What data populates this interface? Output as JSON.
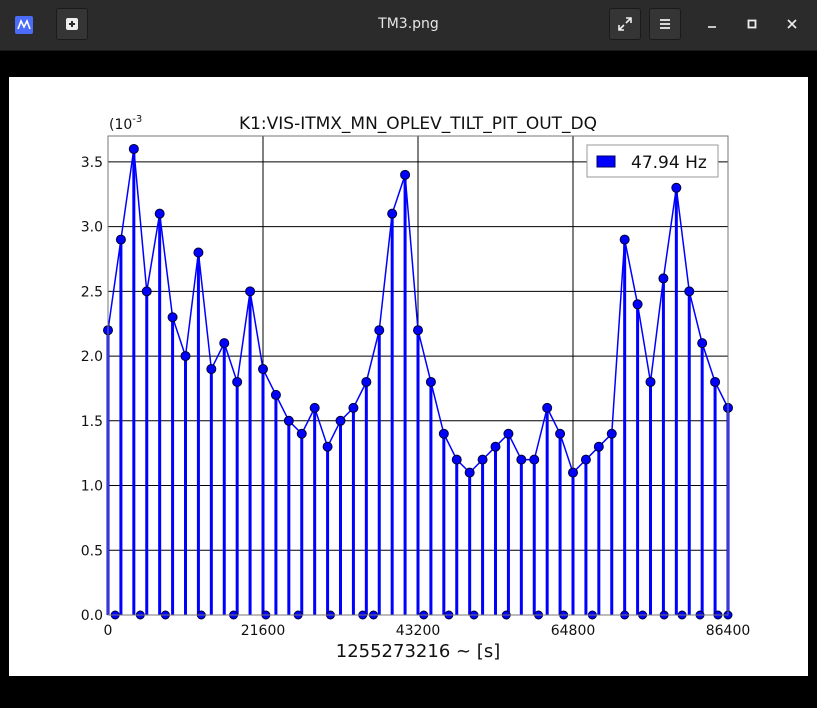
{
  "window": {
    "title": "TM3.png",
    "app_icon": "image-viewer-icon",
    "buttons": {
      "new_tab": "plus-icon",
      "fullscreen": "expand-icon",
      "menu": "hamburger-icon",
      "minimize": "minimize-icon",
      "maximize": "maximize-icon",
      "close": "close-icon"
    }
  },
  "colors": {
    "series": "#0000ff",
    "marker_edge": "#000033",
    "titlebar": "#2b2b2b"
  },
  "chart_data": {
    "type": "scatter",
    "title": "K1:VIS-ITMX_MN_OPLEV_TILT_PIT_OUT_DQ",
    "xlabel": "1255273216 ~ [s]",
    "ylabel": "",
    "y_multiplier": "(10",
    "y_exponent": "-3",
    "xlim": [
      0,
      86400
    ],
    "ylim": [
      0,
      0.0037
    ],
    "xticks": [
      "0",
      "21600",
      "43200",
      "64800",
      "86400"
    ],
    "yticks": [
      "0.0",
      "0.5",
      "1.0",
      "1.5",
      "2.0",
      "2.5",
      "3.0",
      "3.5"
    ],
    "grid": true,
    "legend_position": "top-right",
    "series": [
      {
        "name": "47.94 Hz",
        "x": [
          0,
          1800,
          3600,
          5400,
          7200,
          9000,
          10800,
          12600,
          14400,
          16200,
          18000,
          19800,
          21600,
          23400,
          25200,
          27000,
          28800,
          30600,
          32400,
          34200,
          36000,
          37800,
          39600,
          41400,
          43200,
          45000,
          46800,
          48600,
          50400,
          52200,
          54000,
          55800,
          57600,
          59400,
          61200,
          63000,
          64800,
          66600,
          68400,
          70200,
          72000,
          73800,
          75600,
          77400,
          79200,
          81000,
          82800,
          84600,
          86400
        ],
        "y": [
          0.0022,
          0.0029,
          0.0036,
          0.0025,
          0.0031,
          0.0023,
          0.002,
          0.0028,
          0.0019,
          0.0021,
          0.0018,
          0.0025,
          0.0019,
          0.0017,
          0.0015,
          0.0014,
          0.0016,
          0.0013,
          0.0015,
          0.0016,
          0.0018,
          0.0022,
          0.0031,
          0.0034,
          0.0022,
          0.0018,
          0.0014,
          0.0012,
          0.0011,
          0.0012,
          0.0013,
          0.0014,
          0.0012,
          0.0012,
          0.0016,
          0.0014,
          0.0011,
          0.0012,
          0.0013,
          0.0014,
          0.0029,
          0.0024,
          0.0018,
          0.0026,
          0.0033,
          0.0025,
          0.0021,
          0.0018,
          0.0016
        ],
        "zeros_x": [
          1000,
          4500,
          8000,
          13000,
          17500,
          22000,
          26500,
          31000,
          35500,
          37000,
          44000,
          47500,
          51000,
          55500,
          60000,
          63500,
          67500,
          72000,
          74500,
          77500,
          80000,
          82500,
          85000,
          86400
        ]
      }
    ]
  }
}
